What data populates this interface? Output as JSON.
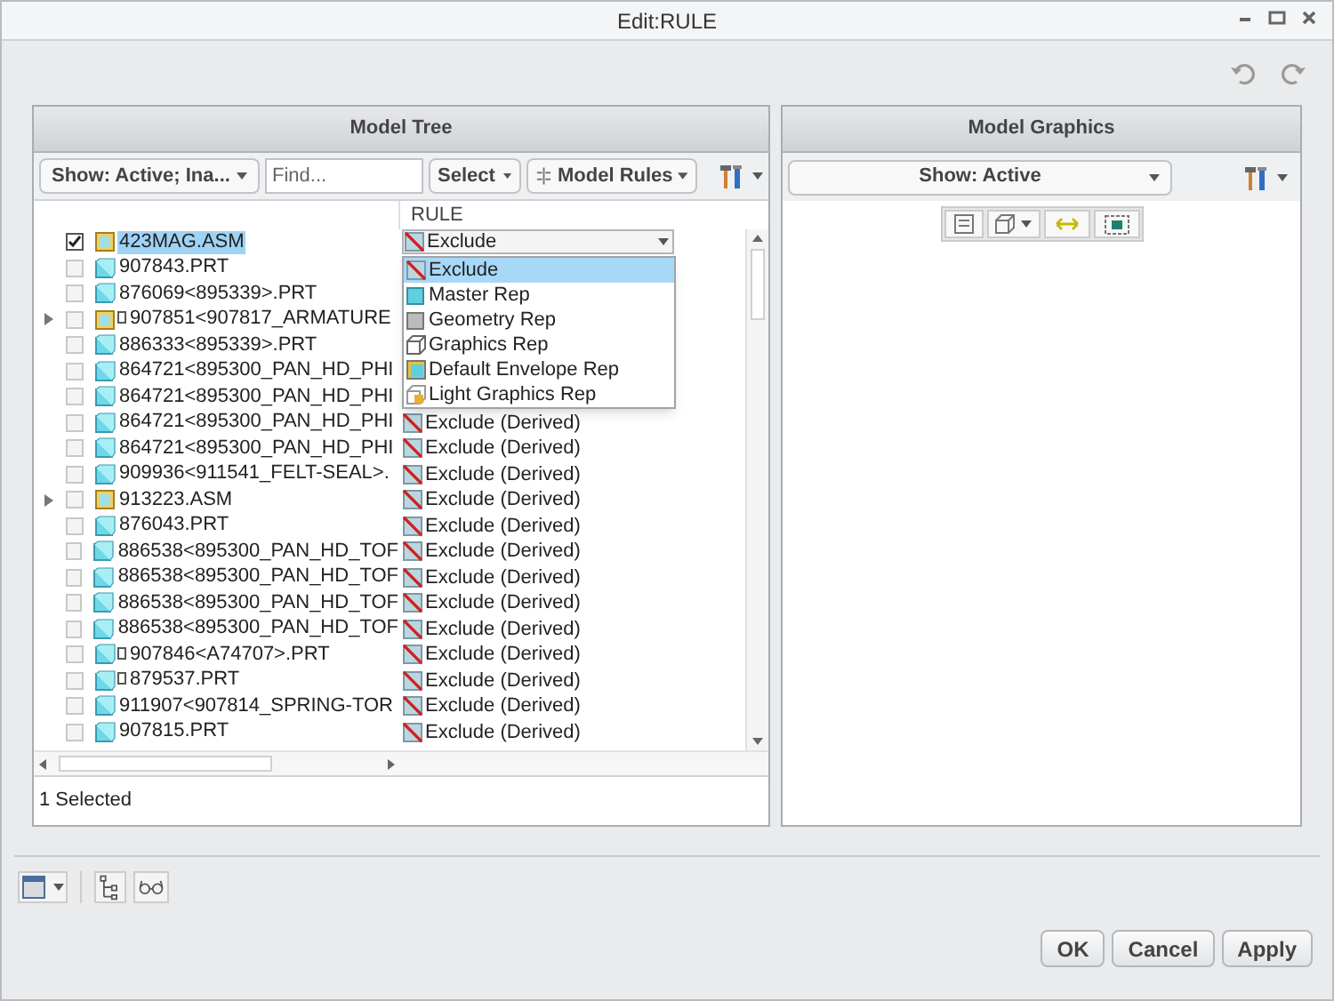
{
  "window": {
    "title": "Edit:RULE"
  },
  "model_tree": {
    "title": "Model Tree",
    "show_filter": "Show: Active; Ina...",
    "find_placeholder": "Find...",
    "select_button": "Select",
    "rules_button": "Model Rules",
    "rule_column": "RULE",
    "rows": [
      {
        "name": "423MAG.ASM",
        "kind": "asm",
        "checked": true,
        "selected": true,
        "rule": "Exclude"
      },
      {
        "name": "907843.PRT",
        "kind": "prt",
        "checked": false,
        "selected": false
      },
      {
        "name": "876069<895339>.PRT",
        "kind": "prt",
        "checked": false,
        "selected": false
      },
      {
        "name": "907851<907817_ARMATURE",
        "kind": "asm",
        "expandable": true,
        "checked": false,
        "selected": false,
        "flagged": true
      },
      {
        "name": "886333<895339>.PRT",
        "kind": "prt",
        "checked": false,
        "selected": false
      },
      {
        "name": "864721<895300_PAN_HD_PHI",
        "kind": "prt",
        "checked": false,
        "selected": false
      },
      {
        "name": "864721<895300_PAN_HD_PHI",
        "kind": "prt",
        "checked": false,
        "selected": false
      },
      {
        "name": "864721<895300_PAN_HD_PHI",
        "kind": "prt",
        "checked": false,
        "selected": false,
        "rule": "Exclude (Derived)"
      },
      {
        "name": "864721<895300_PAN_HD_PHI",
        "kind": "prt",
        "checked": false,
        "selected": false,
        "rule": "Exclude (Derived)"
      },
      {
        "name": "909936<911541_FELT-SEAL>.",
        "kind": "prt",
        "checked": false,
        "selected": false,
        "rule": "Exclude (Derived)"
      },
      {
        "name": "913223.ASM",
        "kind": "asm",
        "expandable": true,
        "checked": false,
        "selected": false,
        "rule": "Exclude (Derived)"
      },
      {
        "name": "876043.PRT",
        "kind": "prt",
        "checked": false,
        "selected": false,
        "rule": "Exclude (Derived)"
      },
      {
        "name": "886538<895300_PAN_HD_TOF",
        "kind": "prt",
        "checked": false,
        "selected": false,
        "rule": "Exclude (Derived)"
      },
      {
        "name": "886538<895300_PAN_HD_TOF",
        "kind": "prt",
        "checked": false,
        "selected": false,
        "rule": "Exclude (Derived)"
      },
      {
        "name": "886538<895300_PAN_HD_TOF",
        "kind": "prt",
        "checked": false,
        "selected": false,
        "rule": "Exclude (Derived)"
      },
      {
        "name": "886538<895300_PAN_HD_TOF",
        "kind": "prt",
        "checked": false,
        "selected": false,
        "rule": "Exclude (Derived)"
      },
      {
        "name": "907846<A74707>.PRT",
        "kind": "prt",
        "checked": false,
        "selected": false,
        "flagged": true,
        "rule": "Exclude (Derived)"
      },
      {
        "name": "879537.PRT",
        "kind": "prt",
        "checked": false,
        "selected": false,
        "flagged": true,
        "rule": "Exclude (Derived)"
      },
      {
        "name": "911907<907814_SPRING-TOR",
        "kind": "prt",
        "checked": false,
        "selected": false,
        "rule": "Exclude (Derived)"
      },
      {
        "name": "907815.PRT",
        "kind": "prt",
        "checked": false,
        "selected": false,
        "rule": "Exclude (Derived)"
      }
    ],
    "rule_options": [
      {
        "label": "Exclude",
        "kind": "exclude",
        "selected": true
      },
      {
        "label": "Master Rep",
        "kind": "master",
        "selected": false
      },
      {
        "label": "Geometry Rep",
        "kind": "geometry",
        "selected": false
      },
      {
        "label": "Graphics Rep",
        "kind": "graphics",
        "selected": false
      },
      {
        "label": "Default Envelope Rep",
        "kind": "envelope",
        "selected": false
      },
      {
        "label": "Light Graphics Rep",
        "kind": "light",
        "selected": false
      }
    ],
    "status": "1 Selected"
  },
  "model_graphics": {
    "title": "Model Graphics",
    "show_filter": "Show: Active"
  },
  "buttons": [
    "OK",
    "Cancel",
    "Apply"
  ]
}
